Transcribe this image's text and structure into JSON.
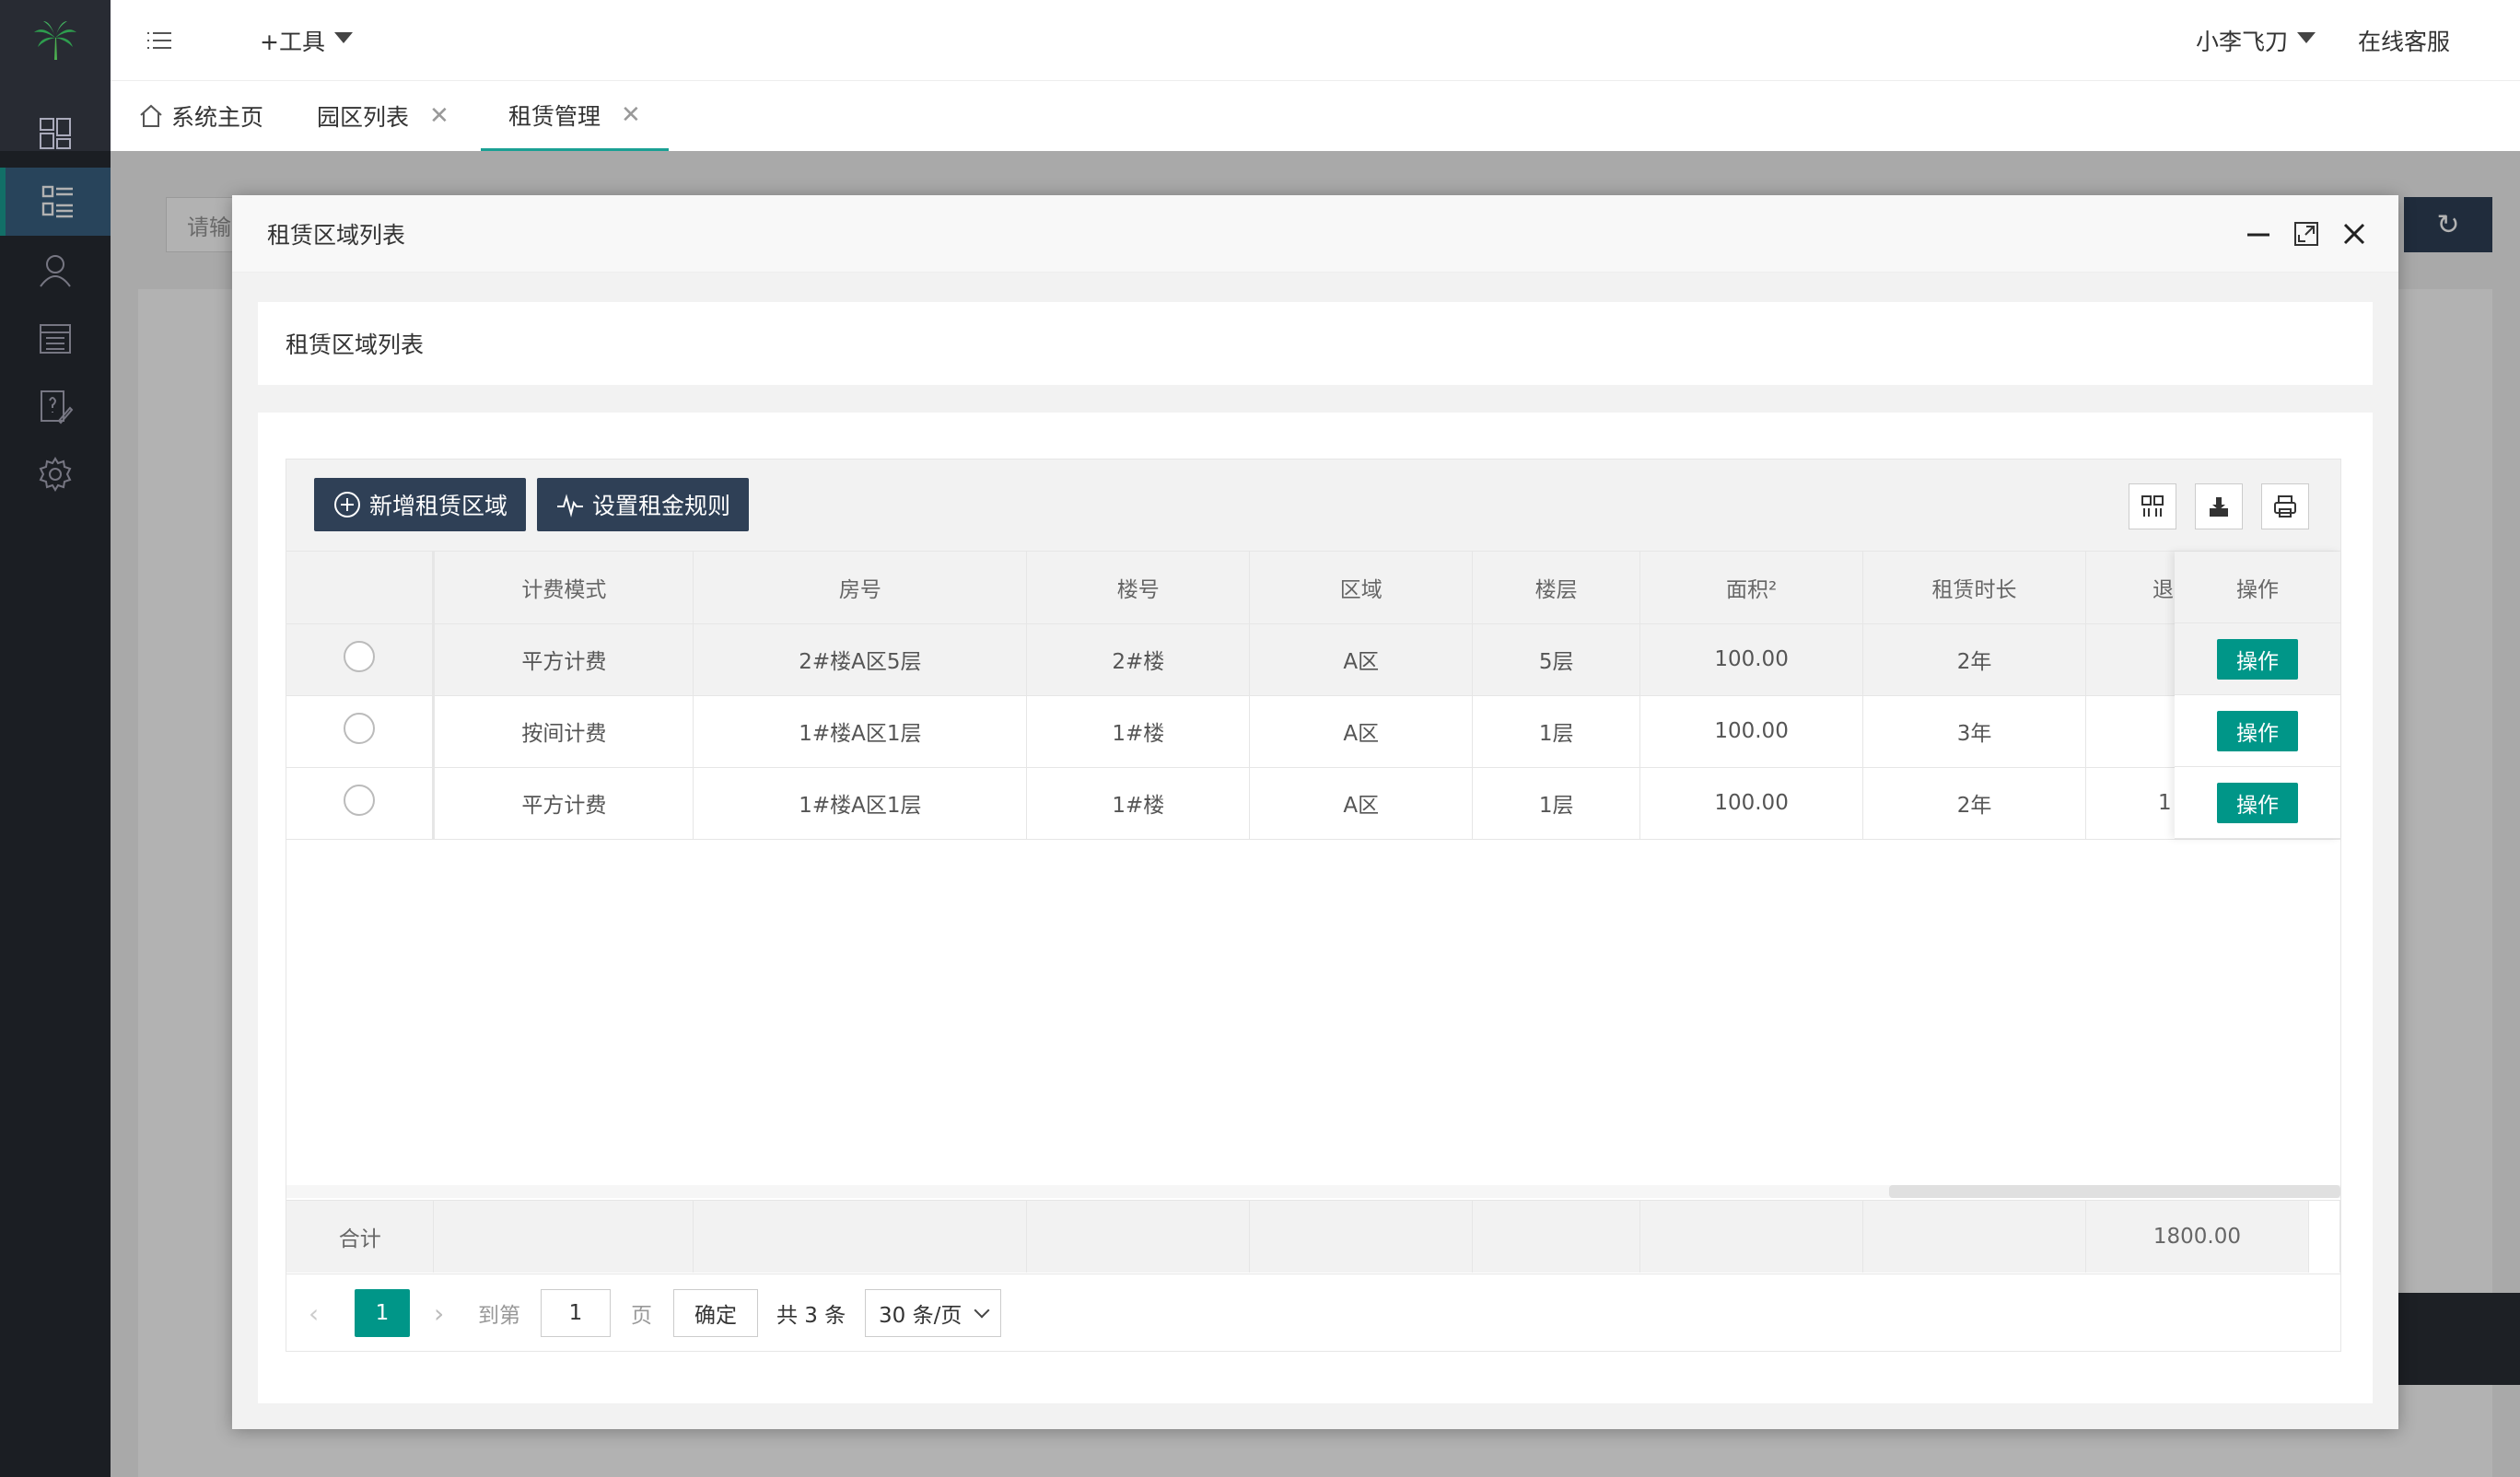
{
  "header": {
    "tools_label": "+工具",
    "user_name": "小李飞刀",
    "support_label": "在线客服"
  },
  "tabs": [
    {
      "label": "系统主页"
    },
    {
      "label": "园区列表"
    },
    {
      "label": "租赁管理"
    }
  ],
  "background": {
    "search_placeholder": "请输"
  },
  "dialog": {
    "title": "租赁区域列表",
    "subtitle": "租赁区域列表",
    "toolbar": {
      "add_label": "新增租赁区域",
      "rule_label": "设置租金规则"
    },
    "columns": [
      "计费模式",
      "房号",
      "楼号",
      "区域",
      "楼层",
      "面积²",
      "租赁时长",
      "退"
    ],
    "action_header": "操作",
    "rows": [
      {
        "mode": "平方计费",
        "room": "2#楼A区5层",
        "building": "2#楼",
        "area": "A区",
        "floor": "5层",
        "size": "100.00",
        "duration": "2年",
        "extra": "",
        "action": "操作"
      },
      {
        "mode": "按间计费",
        "room": "1#楼A区1层",
        "building": "1#楼",
        "area": "A区",
        "floor": "1层",
        "size": "100.00",
        "duration": "3年",
        "extra": "",
        "action": "操作"
      },
      {
        "mode": "平方计费",
        "room": "1#楼A区1层",
        "building": "1#楼",
        "area": "A区",
        "floor": "1层",
        "size": "100.00",
        "duration": "2年",
        "extra": "1",
        "action": "操作"
      }
    ],
    "totals": {
      "label": "合计",
      "value": "1800.00"
    },
    "pager": {
      "current_page": "1",
      "goto_label": "到第",
      "page_input": "1",
      "page_suffix": "页",
      "confirm_label": "确定",
      "total_label": "共 3 条",
      "page_size": "30 条/页"
    }
  },
  "colors": {
    "sidebar_bg": "#282b33",
    "primary_dark": "#2f4056",
    "accent_green": "#009688",
    "tab_active_line": "#1aa094"
  }
}
